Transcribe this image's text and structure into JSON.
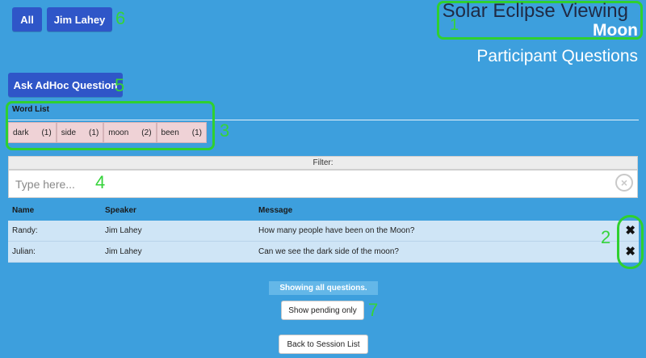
{
  "header": {
    "filter_buttons": [
      {
        "label": "All"
      },
      {
        "label": "Jim Lahey"
      }
    ],
    "session_title": "Solar Eclipse Viewing",
    "session_subtitle": "Moon",
    "page_title": "Participant Questions"
  },
  "actions": {
    "ask_adhoc_label": "Ask AdHoc Question"
  },
  "word_list": {
    "label": "Word List",
    "words": [
      {
        "word": "dark",
        "count": "(1)"
      },
      {
        "word": "side",
        "count": "(1)"
      },
      {
        "word": "moon",
        "count": "(2)"
      },
      {
        "word": "been",
        "count": "(1)"
      }
    ]
  },
  "filter": {
    "label": "Filter:",
    "placeholder": "Type here...",
    "value": ""
  },
  "table": {
    "columns": [
      "Name",
      "Speaker",
      "Message"
    ],
    "rows": [
      {
        "name": "Randy:",
        "speaker": "Jim Lahey",
        "message": "How many people have been on the Moon?"
      },
      {
        "name": "Julian:",
        "speaker": "Jim Lahey",
        "message": "Can we see the dark side of the moon?"
      }
    ]
  },
  "status": {
    "showing_text": "Showing all questions."
  },
  "footer": {
    "pending_label": "Show pending only",
    "back_label": "Back to Session List"
  },
  "annotations": [
    "1",
    "2",
    "3",
    "4",
    "5",
    "6",
    "7"
  ],
  "colors": {
    "background": "#3d9fdd",
    "primary_button": "#2f56c8",
    "annotation_green": "#2fd02f",
    "chip": "#efd2d6",
    "row": "#cfe5f6"
  }
}
